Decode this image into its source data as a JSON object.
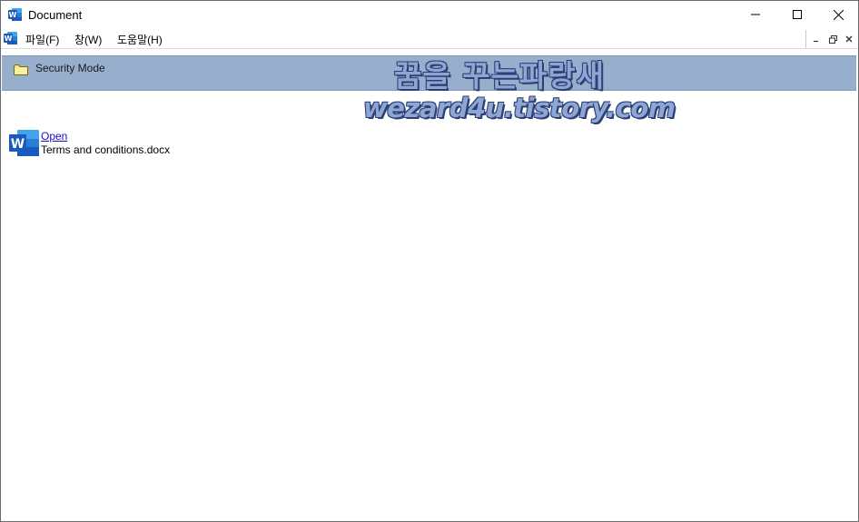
{
  "window": {
    "title": "Document",
    "icons": {
      "app": "word-icon",
      "minimize": "minimize-icon",
      "maximize": "maximize-icon",
      "close": "close-icon"
    }
  },
  "menubar": {
    "items": [
      {
        "label": "파일(F)"
      },
      {
        "label": "창(W)"
      },
      {
        "label": "도움말(H)"
      }
    ],
    "mdi_buttons": [
      "minimize-icon",
      "restore-icon",
      "close-icon"
    ]
  },
  "security_bar": {
    "label": "Security Mode",
    "icon": "folder-icon",
    "background": "#97aecd"
  },
  "watermark": {
    "line1": "꿈을 꾸는파랑새",
    "line2": "wezard4u.tistory.com"
  },
  "document": {
    "icon": "word-document-icon",
    "open_label": "Open",
    "filename": "Terms and conditions.docx"
  },
  "colors": {
    "word_blue": "#185abd",
    "link": "#1a0dcc"
  }
}
